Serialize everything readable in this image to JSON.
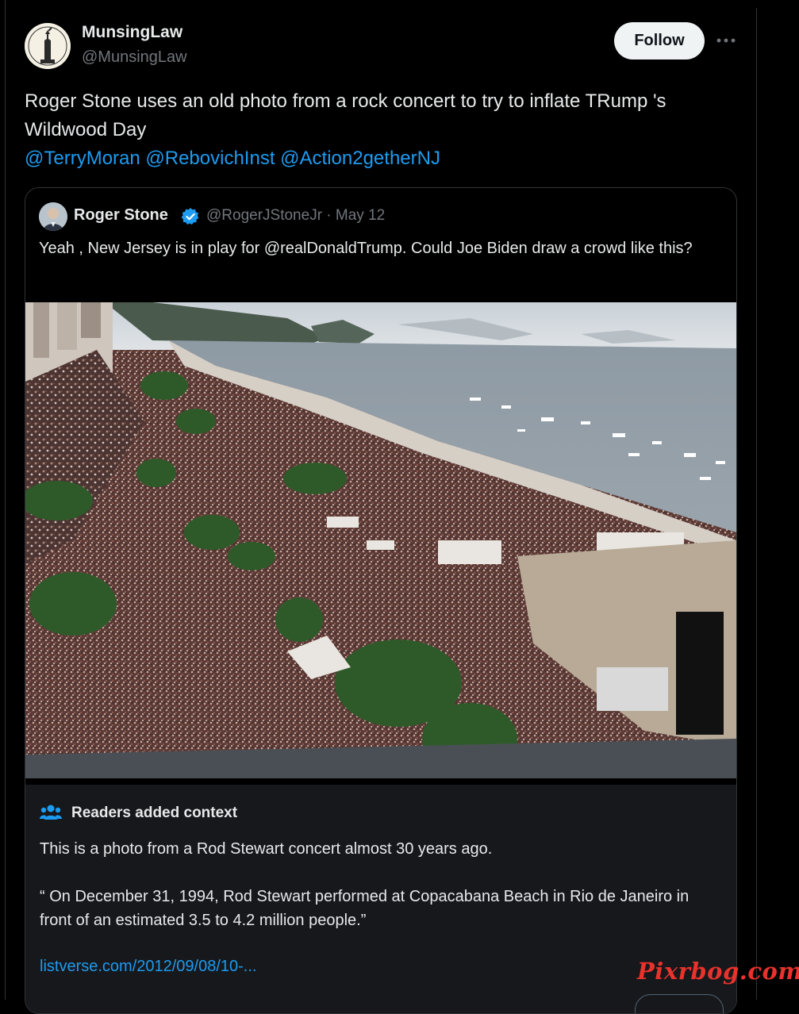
{
  "author": {
    "display_name": "MunsingLaw",
    "handle": "@MunsingLaw",
    "follow_label": "Follow",
    "more_icon": "more-horizontal-icon"
  },
  "tweet": {
    "text_line1": "Roger Stone uses an old photo from a rock concert to try to inflate TRump 's",
    "text_line2": "Wildwood Day",
    "mentions": "@TerryMoran @RebovichInst @Action2getherNJ"
  },
  "quoted": {
    "name": "Roger Stone",
    "verified_icon": "verified-badge-icon",
    "handle_date": "@RogerJStoneJr · May 12",
    "text": "Yeah , New Jersey is in play for @realDonaldTrump. Could Joe Biden draw a crowd like this?",
    "photo_alt": "Aerial photo of a huge crowd on a beach"
  },
  "context": {
    "icon": "people-icon",
    "title": "Readers added context",
    "body": "This is a photo from a Rod Stewart concert almost 30 years ago.",
    "quote": "“ On December 31, 1994, Rod Stewart performed at Copacabana Beach in Rio de Janeiro in front of an estimated 3.5 to 4.2 million people.”",
    "link": "listverse.com/2012/09/08/10-..."
  },
  "watermark": "Pixrbog.com",
  "colors": {
    "background": "#000000",
    "text": "#e7e9ea",
    "muted": "#71767b",
    "link": "#1d9bf0",
    "context_bg": "#16181c",
    "watermark": "#e8322b"
  }
}
